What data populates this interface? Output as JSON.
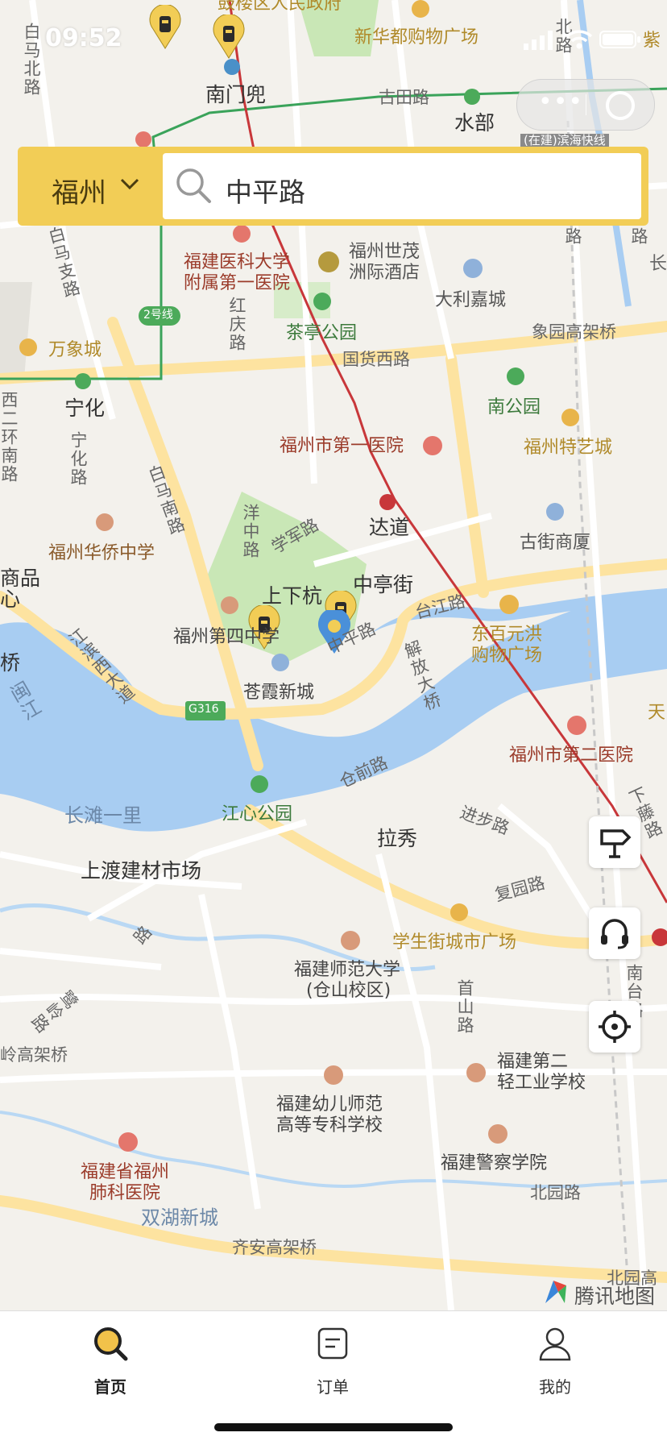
{
  "status_bar": {
    "time": "09:52"
  },
  "search": {
    "city": "福州",
    "query": "中平路"
  },
  "map": {
    "labels": {
      "l1": "新华都购物广场",
      "l2": "南门兜",
      "l3": "古田路",
      "l4": "水部",
      "l5": "(在建)滨海快线",
      "l6": "福建医科大学",
      "l7": "附属第一医院",
      "l8": "福州世茂",
      "l9": "洲际酒店",
      "l10": "大利嘉城",
      "l11": "万象城",
      "l12": "茶亭公园",
      "l13": "象园高架桥",
      "l14": "国货西路",
      "l15": "宁化",
      "l16": "南公园",
      "l17": "福州市第一医院",
      "l18": "福州特艺城",
      "l19": "达道",
      "l20": "古街商厦",
      "l21": "福州华侨中学",
      "l22": "上下杭",
      "l23": "中亭街",
      "l24": "台江路",
      "l25": "福州第四中学",
      "l26": "中平路",
      "l27": "东百元洪",
      "l28": "购物广场",
      "l29": "苍霞新城",
      "l30": "G316",
      "l31": "福州市第二医院",
      "l32": "仓前路",
      "l33": "长滩一里",
      "l34": "江心公园",
      "l35": "拉秀",
      "l36": "进步路",
      "l37": "上渡建材市场",
      "l38": "复园路",
      "l39": "学生街城市广场",
      "l40": "福建师范大学",
      "l41": "(仓山校区)",
      "l42": "福建第二",
      "l43": "轻工业学校",
      "l44": "福建幼儿师范",
      "l45": "高等专科学校",
      "l46": "福建警察学院",
      "l47": "福建省福州",
      "l48": "肺科医院",
      "l49": "北园路",
      "l50": "双湖新城",
      "l51": "齐安高架桥",
      "l52": "北园高",
      "l53": "岭高架桥",
      "l54": "2号线",
      "l55": "学军路",
      "l56": "鼓楼区人民政府",
      "l57": "紫",
      "l58": "长",
      "l59": "天",
      "l60": "桥",
      "l61": "商品",
      "l62": "心",
      "v1": "白马北路",
      "v2": "白马南路",
      "v3": "红庆路",
      "v4": "宁化路",
      "v5": "洋中路",
      "v6": "解放大桥",
      "v7": "江滨西大道",
      "v8": "闽江",
      "v9": "首山路",
      "v10": "南台路",
      "v11": "下藤路",
      "v12": "白马支路",
      "v13": "鹭岭路",
      "v14": "西二环南路",
      "v15": "路",
      "v16": "路",
      "v17": "北路",
      "v18": "路"
    },
    "provider": "腾讯地图"
  },
  "tabs": [
    {
      "label": "首页",
      "icon": "search-icon",
      "active": true
    },
    {
      "label": "订单",
      "icon": "order-icon",
      "active": false
    },
    {
      "label": "我的",
      "icon": "user-icon",
      "active": false
    }
  ],
  "colors": {
    "accent": "#f2cd56",
    "water": "#a8cdf2",
    "road": "#fde3a0",
    "park": "#c9e7b6"
  }
}
